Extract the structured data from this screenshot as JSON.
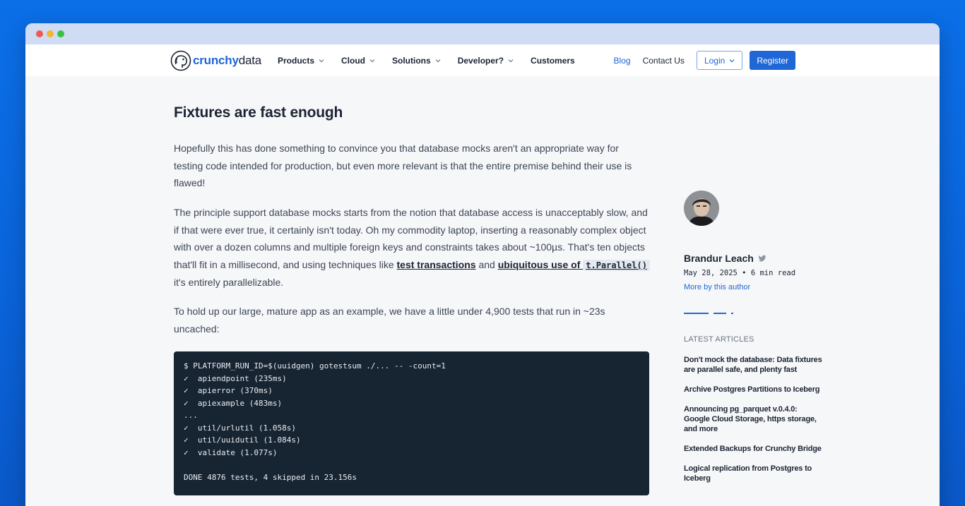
{
  "nav": {
    "logo_bold": "crunchy",
    "logo_light": "data",
    "menu": [
      {
        "label": "Products",
        "has_dropdown": true
      },
      {
        "label": "Cloud",
        "has_dropdown": true
      },
      {
        "label": "Solutions",
        "has_dropdown": true
      },
      {
        "label": "Developer?",
        "has_dropdown": true
      },
      {
        "label": "Customers",
        "has_dropdown": false
      }
    ],
    "blog": "Blog",
    "contact": "Contact Us",
    "login": "Login",
    "register": "Register"
  },
  "article": {
    "heading": "Fixtures are fast enough",
    "p1": "Hopefully this has done something to convince you that database mocks aren't an appropriate way for testing code intended for production, but even more relevant is that the entire premise behind their use is flawed!",
    "p2_before": "The principle support database mocks starts from the notion that database access is unacceptably slow, and if that were ever true, it certainly isn't today. Oh my commodity laptop, inserting a reasonably complex object with over a dozen columns and multiple foreign keys and constraints takes about ~100µs. That's ten objects that'll fit in a millisecond, and using techniques like ",
    "p2_link1": "test transactions",
    "p2_mid": " and ",
    "p2_link2": "ubiquitous use of ",
    "p2_code": "t.Parallel()",
    "p2_after": " it's entirely parallelizable.",
    "p3": "To hold up our large, mature app as an example, we have a little under 4,900 tests that run in ~23s uncached:",
    "code_lines": [
      "$ PLATFORM_RUN_ID=$(uuidgen) gotestsum ./... -- -count=1",
      "✓  apiendpoint (235ms)",
      "✓  apierror (370ms)",
      "✓  apiexample (483ms)",
      "...",
      "✓  util/urlutil (1.058s)",
      "✓  util/uuidutil (1.084s)",
      "✓  validate (1.077s)",
      "",
      "DONE 4876 tests, 4 skipped in 23.156s"
    ]
  },
  "sidebar": {
    "author": "Brandur Leach",
    "meta": "May 28, 2025 • 6 min read",
    "more": "More by this author",
    "latest_heading": "LATEST ARTICLES",
    "latest": [
      "Don't mock the database: Data fixtures are parallel safe, and plenty fast",
      "Archive Postgres Partitions to Iceberg",
      "Announcing pg_parquet v.0.4.0: Google Cloud Storage, https storage, and more",
      "Extended Backups for Crunchy Bridge",
      "Logical replication from Postgres to Iceberg"
    ]
  },
  "colors": {
    "accent": "#1f66d6",
    "text": "#1b2433",
    "code_bg": "#172431",
    "page_bg": "#0b6fe8"
  }
}
